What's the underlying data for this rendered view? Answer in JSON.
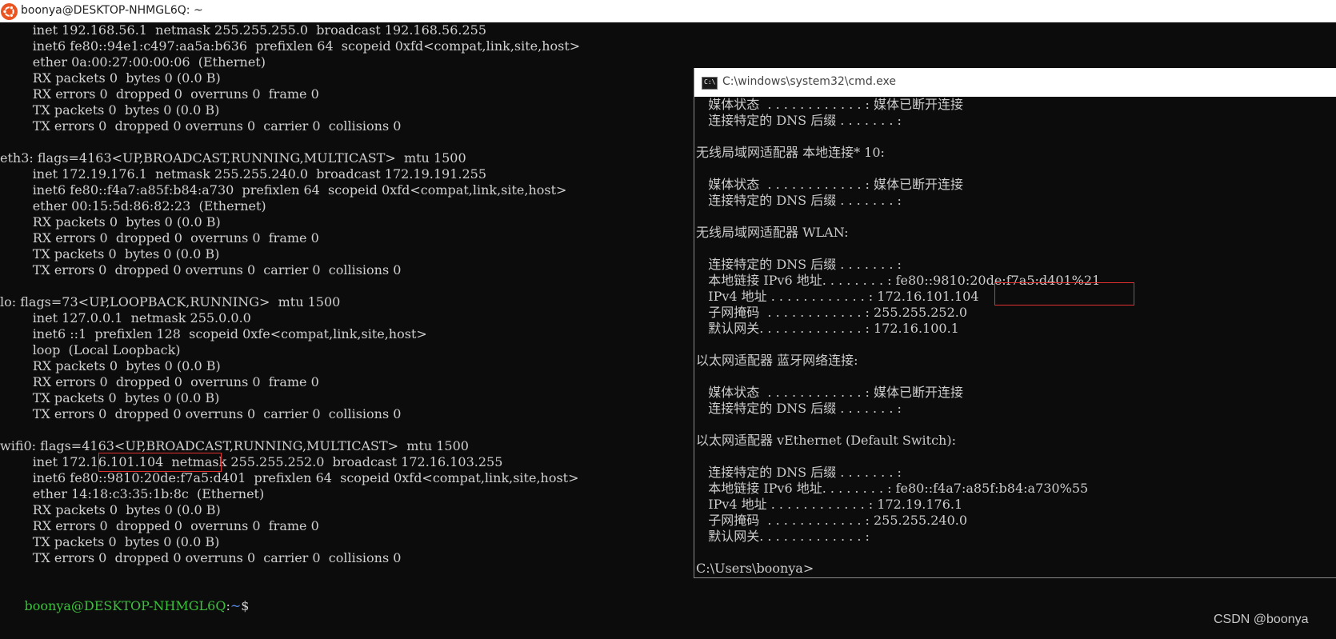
{
  "ubuntu": {
    "title": "boonya@DESKTOP-NHMGL6Q: ~",
    "lines": [
      "        inet 192.168.56.1  netmask 255.255.255.0  broadcast 192.168.56.255",
      "        inet6 fe80::94e1:c497:aa5a:b636  prefixlen 64  scopeid 0xfd<compat,link,site,host>",
      "        ether 0a:00:27:00:00:06  (Ethernet)",
      "        RX packets 0  bytes 0 (0.0 B)",
      "        RX errors 0  dropped 0  overruns 0  frame 0",
      "        TX packets 0  bytes 0 (0.0 B)",
      "        TX errors 0  dropped 0 overruns 0  carrier 0  collisions 0",
      "",
      "eth3: flags=4163<UP,BROADCAST,RUNNING,MULTICAST>  mtu 1500",
      "        inet 172.19.176.1  netmask 255.255.240.0  broadcast 172.19.191.255",
      "        inet6 fe80::f4a7:a85f:b84:a730  prefixlen 64  scopeid 0xfd<compat,link,site,host>",
      "        ether 00:15:5d:86:82:23  (Ethernet)",
      "        RX packets 0  bytes 0 (0.0 B)",
      "        RX errors 0  dropped 0  overruns 0  frame 0",
      "        TX packets 0  bytes 0 (0.0 B)",
      "        TX errors 0  dropped 0 overruns 0  carrier 0  collisions 0",
      "",
      "lo: flags=73<UP,LOOPBACK,RUNNING>  mtu 1500",
      "        inet 127.0.0.1  netmask 255.0.0.0",
      "        inet6 ::1  prefixlen 128  scopeid 0xfe<compat,link,site,host>",
      "        loop  (Local Loopback)",
      "        RX packets 0  bytes 0 (0.0 B)",
      "        RX errors 0  dropped 0  overruns 0  frame 0",
      "        TX packets 0  bytes 0 (0.0 B)",
      "        TX errors 0  dropped 0 overruns 0  carrier 0  collisions 0",
      "",
      "wifi0: flags=4163<UP,BROADCAST,RUNNING,MULTICAST>  mtu 1500",
      "        inet 172.16.101.104  netmask 255.255.252.0  broadcast 172.16.103.255",
      "        inet6 fe80::9810:20de:f7a5:d401  prefixlen 64  scopeid 0xfd<compat,link,site,host>",
      "        ether 14:18:c3:35:1b:8c  (Ethernet)",
      "        RX packets 0  bytes 0 (0.0 B)",
      "        RX errors 0  dropped 0  overruns 0  frame 0",
      "        TX packets 0  bytes 0 (0.0 B)",
      "        TX errors 0  dropped 0 overruns 0  carrier 0  collisions 0",
      ""
    ],
    "prompt": {
      "user": "boonya@DESKTOP-NHMGL6Q",
      "colon": ":",
      "path": "~",
      "sign": "$"
    },
    "colors": {
      "user": "#3cc13c",
      "path": "#5a8fe6",
      "highlight": "#e03030"
    }
  },
  "cmd": {
    "title": "C:\\windows\\system32\\cmd.exe",
    "icon_label": "C:\\",
    "lines": [
      "   媒体状态  . . . . . . . . . . . . : 媒体已断开连接",
      "   连接特定的 DNS 后缀 . . . . . . . :",
      "",
      "无线局域网适配器 本地连接* 10:",
      "",
      "   媒体状态  . . . . . . . . . . . . : 媒体已断开连接",
      "   连接特定的 DNS 后缀 . . . . . . . :",
      "",
      "无线局域网适配器 WLAN:",
      "",
      "   连接特定的 DNS 后缀 . . . . . . . :",
      "   本地链接 IPv6 地址. . . . . . . . : fe80::9810:20de:f7a5:d401%21",
      "   IPv4 地址 . . . . . . . . . . . . : 172.16.101.104",
      "   子网掩码  . . . . . . . . . . . . : 255.255.252.0",
      "   默认网关. . . . . . . . . . . . . : 172.16.100.1",
      "",
      "以太网适配器 蓝牙网络连接:",
      "",
      "   媒体状态  . . . . . . . . . . . . : 媒体已断开连接",
      "   连接特定的 DNS 后缀 . . . . . . . :",
      "",
      "以太网适配器 vEthernet (Default Switch):",
      "",
      "   连接特定的 DNS 后缀 . . . . . . . :",
      "   本地链接 IPv6 地址. . . . . . . . : fe80::f4a7:a85f:b84:a730%55",
      "   IPv4 地址 . . . . . . . . . . . . : 172.19.176.1",
      "   子网掩码  . . . . . . . . . . . . : 255.255.240.0",
      "   默认网关. . . . . . . . . . . . . :",
      "",
      "C:\\Users\\boonya>"
    ]
  },
  "watermark": "CSDN @boonya"
}
